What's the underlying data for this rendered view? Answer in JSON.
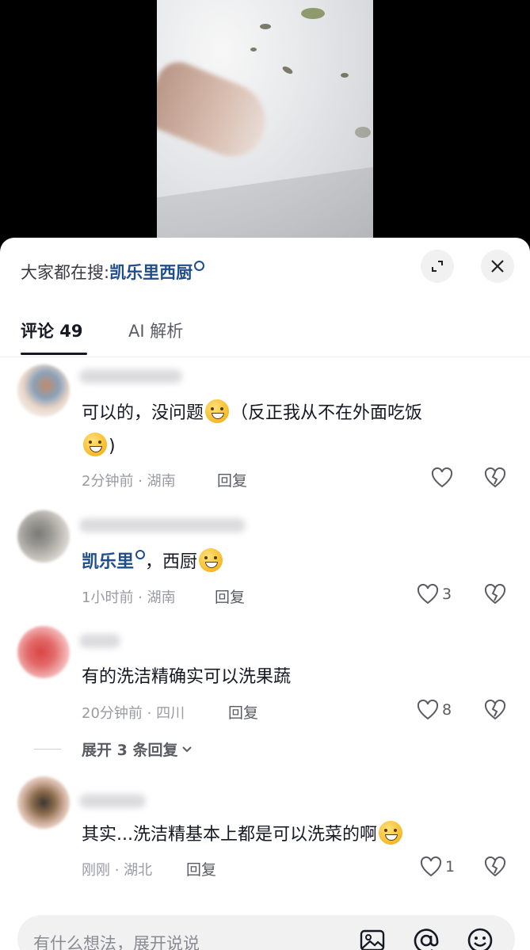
{
  "search_hint": {
    "prefix": "大家都在搜:",
    "query": "凯乐里西厨"
  },
  "tabs": [
    {
      "label": "评论 49",
      "active": true
    },
    {
      "label": "AI 解析",
      "active": false
    }
  ],
  "comments": [
    {
      "text_before": "可以的，没问题",
      "text_after": "（反正我从不在外面吃饭",
      "text_line2_after": ")",
      "meta": "2分钟前 · 湖南",
      "reply_label": "回复",
      "likes": ""
    },
    {
      "link_text": "凯乐里",
      "text_after": "，西厨",
      "meta": "1小时前 · 湖南",
      "reply_label": "回复",
      "likes": "3"
    },
    {
      "text": "有的洗洁精确实可以洗果蔬",
      "meta": "20分钟前 · 四川",
      "reply_label": "回复",
      "likes": "8",
      "more_replies": "展开 3 条回复"
    },
    {
      "text": "其实...洗洁精基本上都是可以洗菜的啊",
      "meta": "刚刚 · 湖北",
      "reply_label": "回复",
      "likes": "1"
    }
  ],
  "input": {
    "placeholder": "有什么想法，展开说说"
  },
  "icons": {
    "expand": "expand-icon",
    "close": "close-icon",
    "like": "heart-icon",
    "dislike": "broken-heart-icon",
    "image": "image-icon",
    "mention": "at-icon",
    "emoji": "emoji-icon"
  },
  "colors": {
    "link": "#1f4e8c",
    "text": "#161823",
    "muted": "#9a9ba2"
  }
}
